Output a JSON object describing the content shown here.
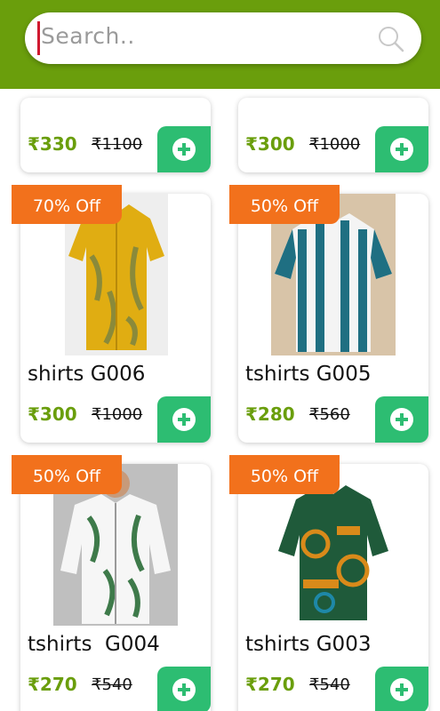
{
  "search": {
    "placeholder": "Search.."
  },
  "top_row": [
    {
      "price": "₹330",
      "mrp": "₹1100"
    },
    {
      "price": "₹300",
      "mrp": "₹1000"
    }
  ],
  "products": [
    {
      "discount": "70% Off",
      "name": "shirts G006",
      "price": "₹300",
      "mrp": "₹1000",
      "image": "yellow-leaf-shirt"
    },
    {
      "discount": "50% Off",
      "name": "tshirts G005",
      "price": "₹280",
      "mrp": "₹560",
      "image": "blue-striped-shirt"
    },
    {
      "discount": "50% Off",
      "name": "tshirts  G004",
      "price": "₹270",
      "mrp": "₹540",
      "image": "green-leaf-shirt"
    },
    {
      "discount": "50% Off",
      "name": "tshirts G003",
      "price": "₹270",
      "mrp": "₹540",
      "image": "green-orange-pattern-shirt"
    }
  ],
  "colors": {
    "header": "#6a9e0c",
    "badge": "#f2711c",
    "add": "#2dbd72",
    "price": "#6a9e0c"
  }
}
